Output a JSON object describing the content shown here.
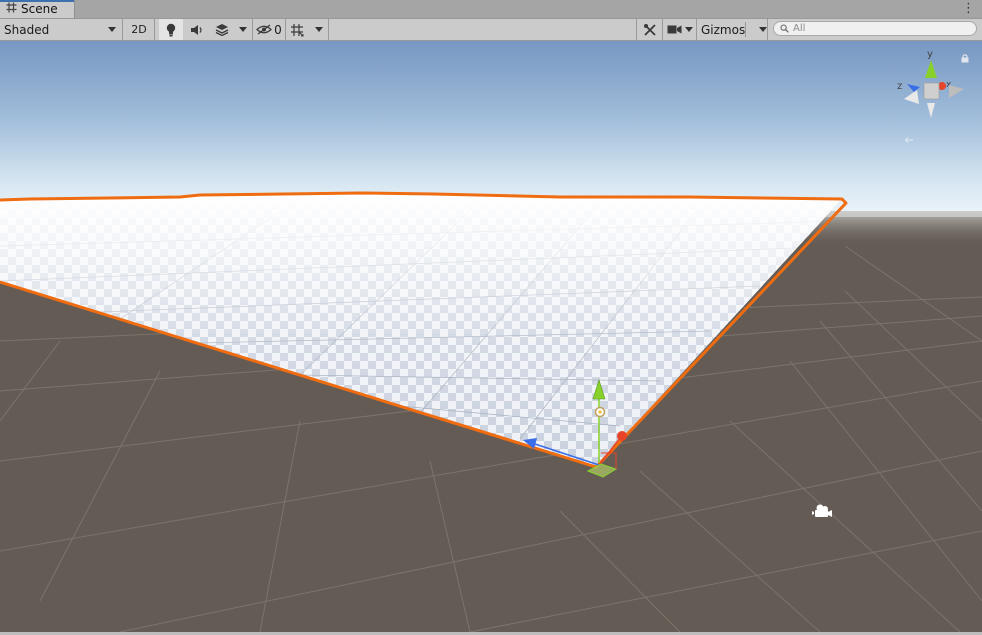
{
  "tab": {
    "title": "Scene",
    "icon": "grid-hash-icon",
    "menu_glyph": "⋮"
  },
  "toolbar": {
    "draw_mode": "Shaded",
    "btn_2d": "2D",
    "hidden_count": "0",
    "gizmos_label": "Gizmos",
    "search_placeholder": "All"
  },
  "view_gizmo": {
    "axis_y": "y",
    "axis_x": "x",
    "axis_z": "z",
    "persp_label": ""
  },
  "colors": {
    "selection_outline": "#ef6c11",
    "axis_x": "#e8442a",
    "axis_y": "#87d12a",
    "axis_z": "#3a6ee8",
    "ground": "#645c54",
    "sky_top": "#7a9ac5"
  },
  "icons": [
    "grid-hash-icon",
    "lightbulb-icon",
    "speaker-icon",
    "effects-layers-icon",
    "hidden-eye-icon",
    "grid-snap-icon",
    "tools-icon",
    "camera-icon",
    "search-icon",
    "lock-icon",
    "scene-camera-icon",
    "scene-view-gizmo"
  ]
}
